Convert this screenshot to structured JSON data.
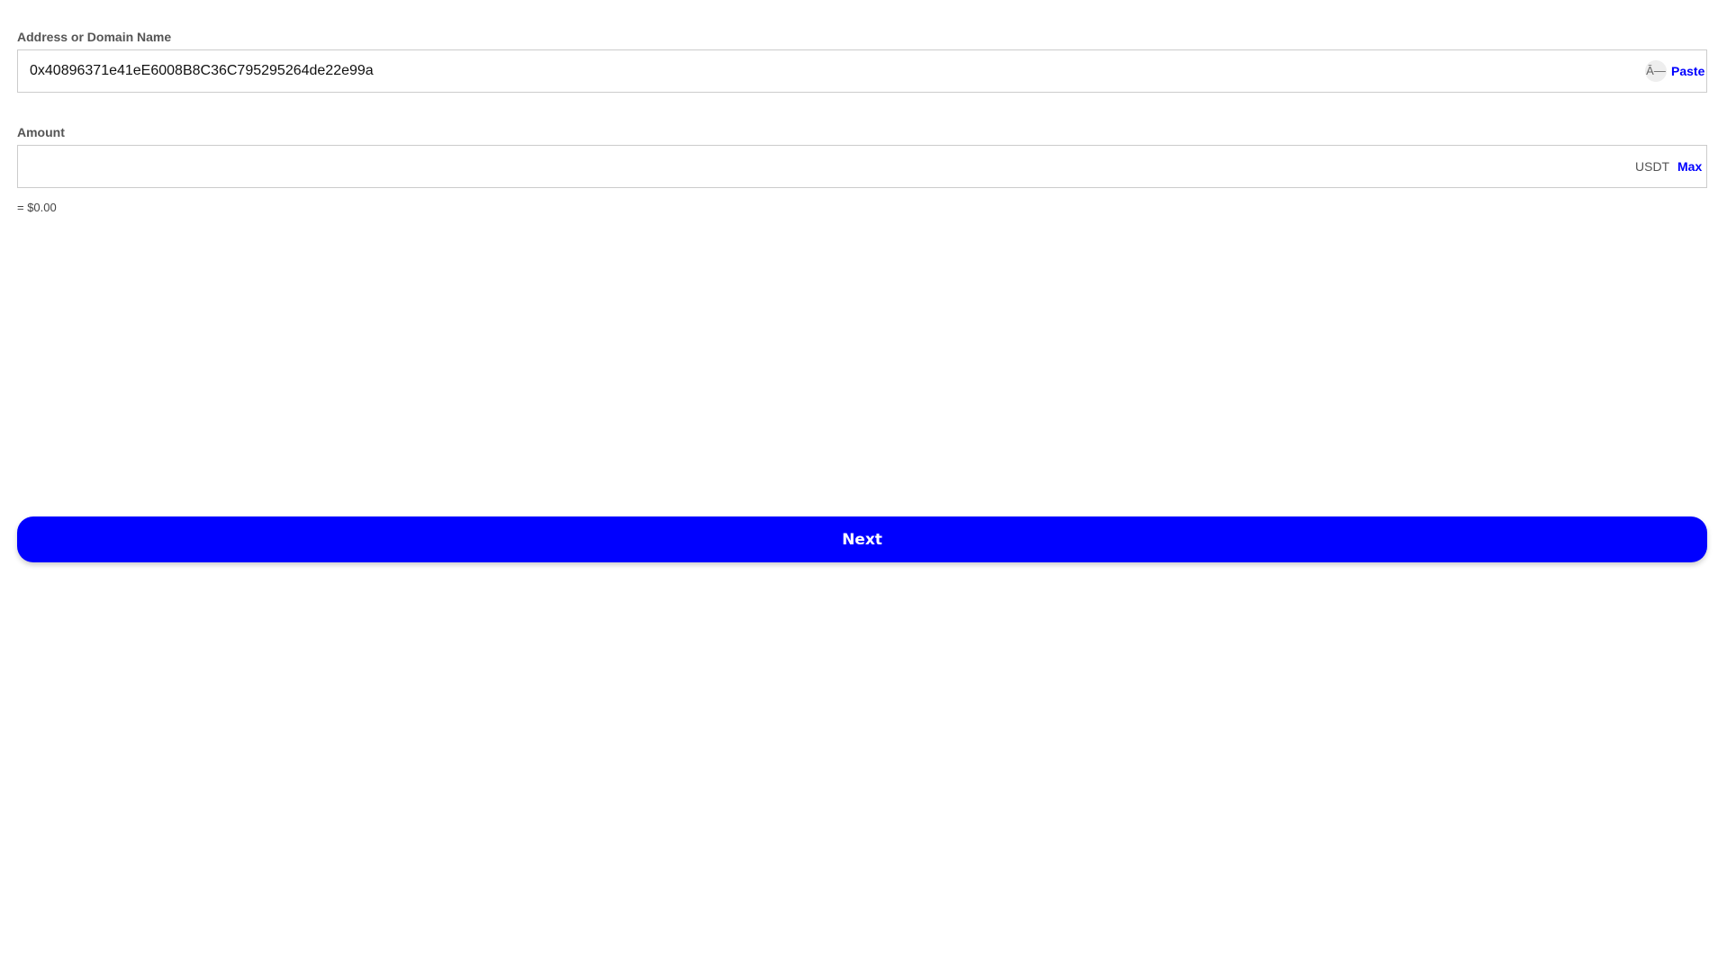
{
  "address": {
    "label": "Address or Domain Name",
    "value": "0x40896371e41eE6008B8C36C795295264de22e99a",
    "scan_icon_glyph": "Ā—",
    "scan_icon": "qr-scan-icon",
    "paste_label": "Paste"
  },
  "amount": {
    "label": "Amount",
    "value": "",
    "unit": "USDT",
    "max_label": "Max",
    "fiat_value": "= $0.00"
  },
  "next_button": {
    "label": "Next"
  },
  "colors": {
    "accent": "#0000ff",
    "label_text": "#555555",
    "border": "#cccccc"
  }
}
